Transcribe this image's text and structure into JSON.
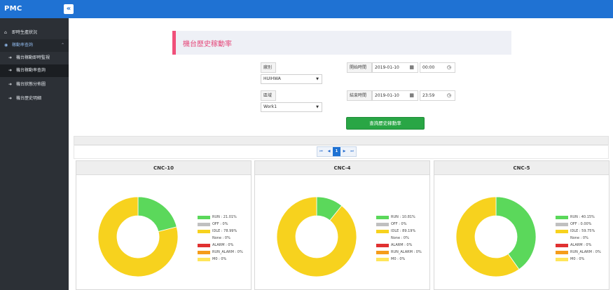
{
  "app": {
    "brand": "PMC",
    "collapse_icon": "double-chevron-left"
  },
  "sidebar": {
    "items": [
      {
        "label": "即時生產狀況",
        "icon": "home-icon",
        "type": "top"
      },
      {
        "label": "稼動率查詢",
        "icon": "eye-icon",
        "type": "group"
      },
      {
        "label": "機台稼動即時監視",
        "icon": "signin-icon",
        "type": "sub"
      },
      {
        "label": "機台稼動率查詢",
        "icon": "signin-icon",
        "type": "sub",
        "active": true
      },
      {
        "label": "機台狀態分佈圖",
        "icon": "signin-icon",
        "type": "sub"
      },
      {
        "label": "機台歷史明細",
        "icon": "signin-icon",
        "type": "sub"
      }
    ]
  },
  "page": {
    "title": "機台歷史稼動率"
  },
  "filters": {
    "factory_label": "廠別",
    "factory_value": "HUIHWA",
    "area_label": "區域",
    "area_value": "Work1",
    "start_label": "開始時間",
    "start_date": "2019-01-10",
    "start_time": "00:00",
    "end_label": "結束時間",
    "end_date": "2019-01-10",
    "end_time": "23:59"
  },
  "query_button": "查詢歷史稼動率",
  "pagination": {
    "current": "1",
    "first": "⏮",
    "prev": "◀",
    "next": "▶",
    "last": "⏭"
  },
  "colors": {
    "RUN": "#5bd85b",
    "OFF": "#c0c0c0",
    "IDLE": "#f7d21e",
    "None": "#ffffff",
    "ALARM": "#e03131",
    "RUN_ALARM": "#f59c1a",
    "M0": "#ffe55a"
  },
  "chart_data": [
    {
      "type": "pie",
      "title": "CNC-10",
      "labels": [
        "RUN",
        "OFF",
        "IDLE",
        "None",
        "ALARM",
        "RUN_ALARM",
        "M0"
      ],
      "values": [
        21.01,
        0,
        78.99,
        0,
        0,
        0,
        0
      ],
      "legend": [
        "RUN : 21.01%",
        "OFF : 0%",
        "IDLE : 78.99%",
        "None : 0%",
        "ALARM : 0%",
        "RUN_ALARM : 0%",
        "M0 : 0%"
      ]
    },
    {
      "type": "pie",
      "title": "CNC-4",
      "labels": [
        "RUN",
        "OFF",
        "IDLE",
        "None",
        "ALARM",
        "RUN_ALARM",
        "M0"
      ],
      "values": [
        10.81,
        0,
        89.19,
        0,
        0,
        0,
        0
      ],
      "legend": [
        "RUN : 10.81%",
        "OFF : 0%",
        "IDLE : 89.19%",
        "None : 0%",
        "ALARM : 0%",
        "RUN_ALARM : 0%",
        "M0 : 0%"
      ]
    },
    {
      "type": "pie",
      "title": "CNC-5",
      "labels": [
        "RUN",
        "OFF",
        "IDLE",
        "None",
        "ALARM",
        "RUN_ALARM",
        "M0"
      ],
      "values": [
        40.15,
        0,
        59.75,
        0,
        0,
        0,
        0
      ],
      "legend": [
        "RUN : 40.15%",
        "OFF : 0.00%",
        "IDLE : 59.75%",
        "None : 0%",
        "ALARM : 0%",
        "RUN_ALARM : 0%",
        "M0 : 0%"
      ]
    }
  ]
}
